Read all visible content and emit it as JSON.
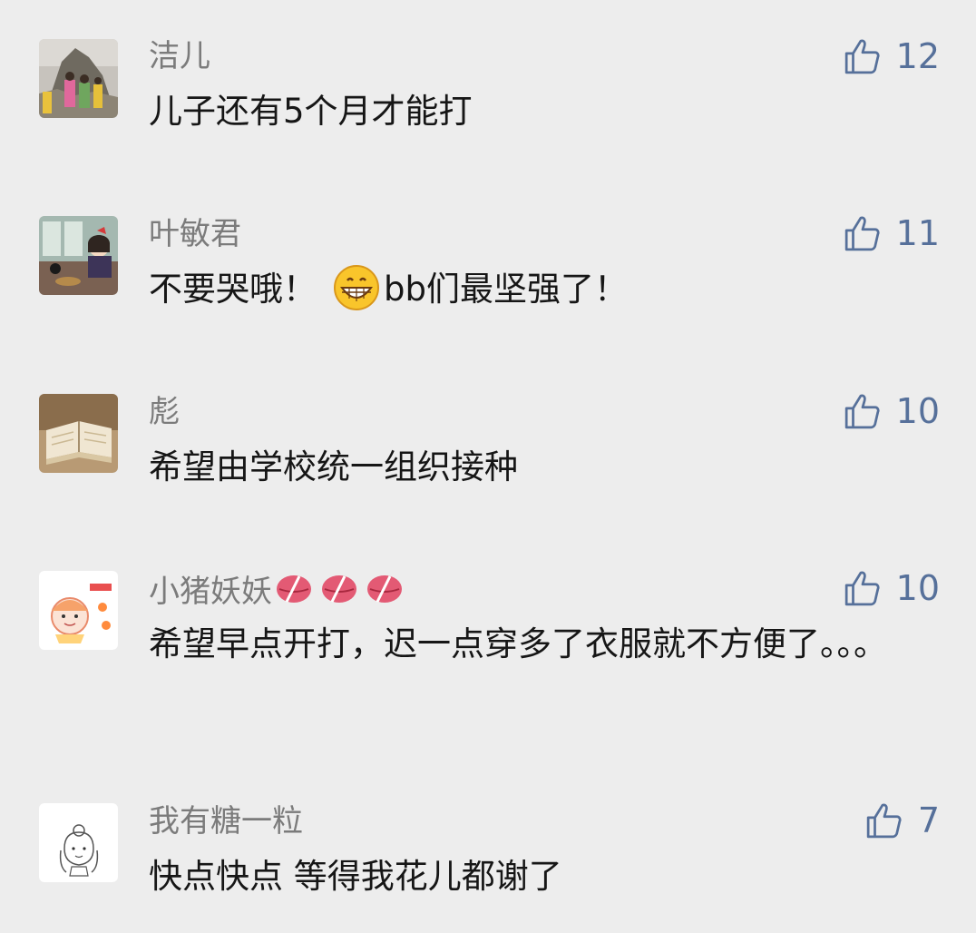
{
  "colors": {
    "background": "#ededed",
    "username": "#7b7b7b",
    "content": "#161616",
    "like": "#56709a"
  },
  "comments": [
    {
      "username": "洁儿",
      "text": "儿子还有5个月才能打",
      "likes": "12",
      "avatar_icon": "mountain-people-photo-icon"
    },
    {
      "username": "叶敏君",
      "text_before": "不要哭哦！",
      "emoji": "grinning-face-icon",
      "text_after": "bb们最坚强了！",
      "likes": "11",
      "avatar_icon": "anime-girl-window-icon"
    },
    {
      "username": "彪",
      "text": "希望由学校统一组织接种",
      "likes": "10",
      "avatar_icon": "open-book-icon"
    },
    {
      "username": "小猪妖妖",
      "username_emoji": "kiss-lips-icon",
      "text": "希望早点开打，迟一点穿多了衣服就不方便了。。。",
      "likes": "10",
      "avatar_icon": "cartoon-sticker-icon"
    },
    {
      "username": "我有糖一粒",
      "text": "快点快点 等得我花儿都谢了",
      "likes": "7",
      "avatar_icon": "sketch-girl-icon"
    }
  ]
}
